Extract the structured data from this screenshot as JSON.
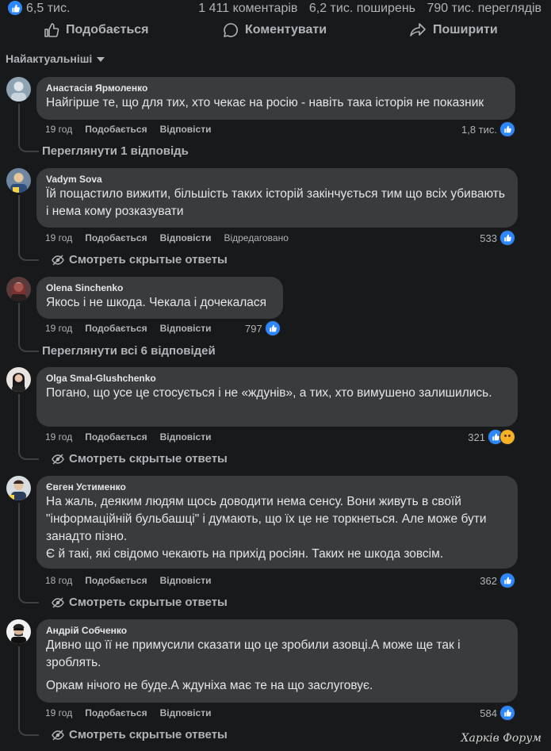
{
  "stats": {
    "likes": "6,5 тис.",
    "comments": "1 411 коментарів",
    "shares": "6,2 тис. поширень",
    "views": "790 тис. переглядів"
  },
  "actions": {
    "like": "Подобається",
    "comment": "Коментувати",
    "share": "Поширити"
  },
  "sort_label": "Найактуальніші",
  "colors": {
    "background": "#18191a",
    "bubble": "#3a3b3c",
    "like_blue": "#2d88ff",
    "muted": "#b0b3b8"
  },
  "comments": [
    {
      "author": "Анастасія Ярмоленко",
      "text": [
        "Найгірше те, що для тих, хто чекає на росію - навіть така історія не показник"
      ],
      "time": "19 год",
      "like": "Подобається",
      "reply": "Відповісти",
      "reactions": "1,8 тис.",
      "replies_link": "Переглянути 1 відповідь"
    },
    {
      "author": "Vadym Sova",
      "text": [
        "Їй пощастило вижити, більшість таких історій закінчується тим що всіх убивають і нема кому розказувати"
      ],
      "time": "19 год",
      "like": "Подобається",
      "reply": "Відповісти",
      "edited": "Відредаговано",
      "reactions": "533",
      "replies_link": "Смотреть скрытые ответы"
    },
    {
      "author": "Olena Sinchenko",
      "text": [
        "Якось і не шкода. Чекала і дочекалася"
      ],
      "time": "19 год",
      "like": "Подобається",
      "reply": "Відповісти",
      "reactions": "797",
      "replies_link": "Переглянути всі 6 відповідей"
    },
    {
      "author": "Olga Smal-Glushchenko",
      "text": [
        "Погано, що усе це стосується і не «ждунів», а тих, хто вимушено залишились."
      ],
      "time": "19 год",
      "like": "Подобається",
      "reply": "Відповісти",
      "reactions": "321",
      "replies_link": "Смотреть скрытые ответы"
    },
    {
      "author": "Євген Устименко",
      "text": [
        "На жаль, деяким людям щось доводити нема сенсу. Вони живуть в своїй \"інформаційній бульбашці\" і думають, що їх це не торкнеться. Але може бути занадто пізно.",
        "Є й такі, які свідомо чекають на прихід росіян. Таких не шкода зовсім."
      ],
      "time": "18 год",
      "like": "Подобається",
      "reply": "Відповісти",
      "reactions": "362",
      "replies_link": "Смотреть скрытые ответы"
    },
    {
      "author": "Андрій Собченко",
      "text": [
        "Дивно що її не примусили сказати що це зробили азовці.А може ще так і зроблять.",
        "Оркам нічого не буде.А ждуніха має те на що заслуговує."
      ],
      "time": "19 год",
      "like": "Подобається",
      "reply": "Відповісти",
      "reactions": "584",
      "replies_link": "Смотреть скрытые ответы"
    }
  ],
  "watermark": "Харків Форум"
}
